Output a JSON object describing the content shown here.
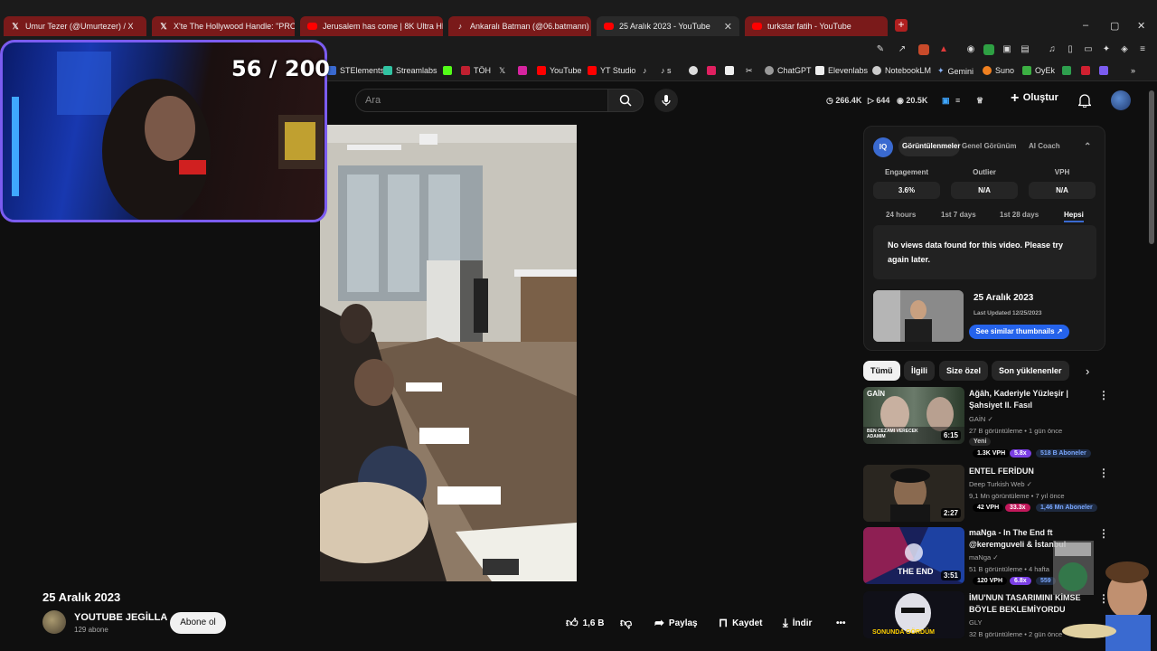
{
  "tabs": [
    {
      "label": "Umur Tezer (@Umurtezer) / X",
      "icon": "x-icon"
    },
    {
      "label": "X'te The Hollywood Handle: \"PROJE",
      "icon": "x-icon"
    },
    {
      "label": "Jerusalem has come | 8K Ultra HD Ci",
      "icon": "youtube-icon"
    },
    {
      "label": "Ankaralı Batman (@06.batmann) | Tik",
      "icon": "tiktok-icon"
    },
    {
      "label": "25 Aralık 2023 - YouTube",
      "icon": "youtube-icon"
    },
    {
      "label": "turkstar fatih - YouTube",
      "icon": "youtube-icon"
    }
  ],
  "new_tab": "+",
  "window": {
    "minimize": "–",
    "maximize": "▢",
    "close": "✕"
  },
  "bookmarks": [
    "STElements",
    "Streamlabs",
    "",
    "TÖH",
    "",
    "",
    "YouTube",
    "YT Studio",
    "",
    "s",
    "",
    "",
    "",
    "",
    "ChatGPT",
    "Elevenlabs",
    "NotebookLM",
    "Gemini",
    "Suno",
    "OyEk"
  ],
  "stream_counter": "56 / 200",
  "search": {
    "placeholder": "Ara"
  },
  "header_stats": {
    "views": "266.4K",
    "videos": "644",
    "eye": "20.5K"
  },
  "create_label": "Oluştur",
  "video": {
    "title": "25 Aralık 2023",
    "channel": "YOUTUBE JEGİLLA",
    "subs": "129 abone",
    "subscribe": "Abone ol",
    "likes": "1,6 B",
    "share": "Paylaş",
    "save": "Kaydet",
    "download": "İndir",
    "more": "•••"
  },
  "panel": {
    "logo": "IQ",
    "tabs": [
      "Görüntülenmeler",
      "Genel Görünüm",
      "AI Coach"
    ],
    "metrics": [
      {
        "label": "Engagement",
        "value": "3.6%"
      },
      {
        "label": "Outlier",
        "value": "N/A"
      },
      {
        "label": "VPH",
        "value": "N/A"
      }
    ],
    "ranges": [
      "24 hours",
      "1st 7 days",
      "1st 28 days",
      "Hepsi"
    ],
    "no_data": "No views data found for this video. Please try again later.",
    "thumb_title": "25 Aralık 2023",
    "last_updated": "Last Updated 12/25/2023",
    "similar_btn": "See similar thumbnails ↗"
  },
  "chips": [
    "Tümü",
    "İlgili",
    "Size özel",
    "Son yüklenenler"
  ],
  "recs": [
    {
      "title": "Ağâh, Kaderiyle Yüzleşir | Şahsiyet II. Fasıl",
      "channel": "GAİN",
      "meta": "27 B görüntüleme • 1 gün önce",
      "new": "Yeni",
      "duration": "6:15",
      "vph": "1.3K VPH",
      "mult": "5.8x",
      "subs": "518 B Aboneler",
      "thumb_text": "GAİN",
      "thumb_caption": "BEN CEZAMI VERECEK ADAMIM"
    },
    {
      "title": "ENTEL FERİDUN",
      "channel": "Deep Turkish Web",
      "meta": "9,1 Mn görüntüleme • 7 yıl önce",
      "duration": "2:27",
      "vph": "42 VPH",
      "mult": "33.3x",
      "subs": "1,46 Mn Aboneler"
    },
    {
      "title": "maNga - In The End ft @keremguveli & İstanbul",
      "channel": "maNga",
      "meta": "51 B görüntüleme • 4 hafta",
      "duration": "3:51",
      "vph": "120 VPH",
      "mult": "6.8x",
      "subs": "559",
      "thumb_caption": "THE END"
    },
    {
      "title": "İMU'NUN TASARIMINI KİMSE BÖYLE BEKLEMİYORDU",
      "channel": "GLY",
      "meta": "32 B görüntüleme • 2 gün önce",
      "thumb_caption": "SONUNDA GÖRDÜM"
    }
  ],
  "colors": {
    "accent": "#3ea6ff",
    "badge_purple": "#7b3fe4",
    "badge_pink": "#c2185b",
    "tab_red": "#7a1a1a"
  }
}
